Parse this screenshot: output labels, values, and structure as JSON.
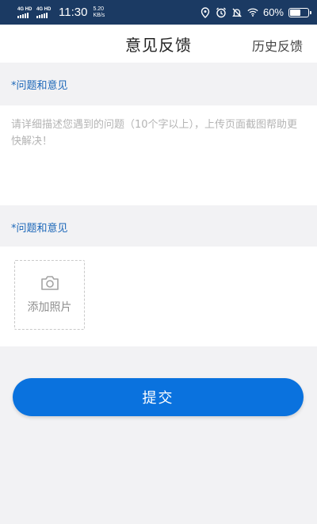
{
  "status_bar": {
    "network_1": "4G HD",
    "network_2": "4G HD",
    "time": "11:30",
    "speed_value": "5.20",
    "speed_unit": "KB/s",
    "battery_percent": "60%",
    "battery_level": 0.6,
    "icons": [
      "location-icon",
      "alarm-icon",
      "mute-icon",
      "wifi-icon",
      "battery-icon"
    ]
  },
  "header": {
    "title": "意见反馈",
    "history_label": "历史反馈"
  },
  "feedback_section": {
    "label": "*问题和意见",
    "placeholder": "请详细描述您遇到的问题（10个字以上），上传页面截图帮助更快解决！"
  },
  "photo_section": {
    "label": "*问题和意见",
    "add_photo_label": "添加照片",
    "add_photo_icon": "camera-icon"
  },
  "submit": {
    "label": "提交"
  },
  "colors": {
    "status_bar_bg": "#1b3a63",
    "accent": "#0a72de",
    "label_blue": "#1a66b8",
    "page_bg": "#f2f2f4"
  }
}
